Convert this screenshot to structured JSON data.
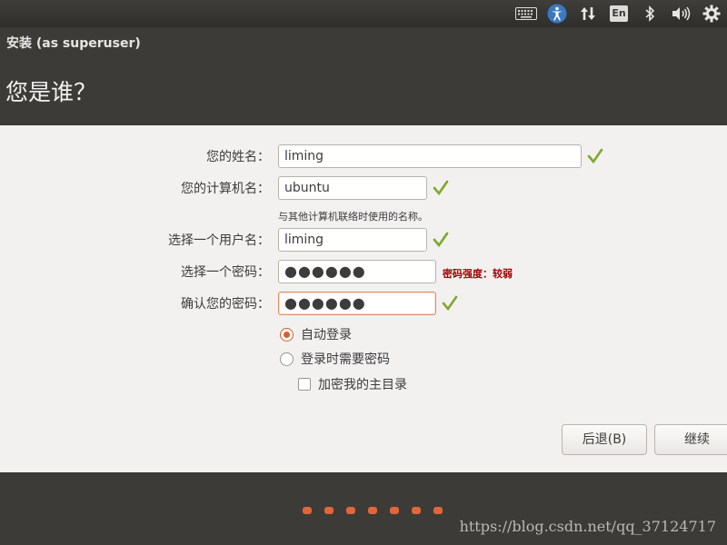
{
  "window": {
    "title": "安装 (as superuser)"
  },
  "page": {
    "title": "您是谁？"
  },
  "tray": {
    "items": [
      {
        "icon": "keyboard-icon"
      },
      {
        "icon": "accessibility-icon"
      },
      {
        "icon": "network-transfer-icon"
      },
      {
        "icon": "keyboard-layout-icon",
        "label": "En"
      },
      {
        "icon": "bluetooth-icon"
      },
      {
        "icon": "volume-icon"
      },
      {
        "icon": "settings-gear-icon"
      }
    ]
  },
  "form": {
    "name": {
      "label": "您的姓名：",
      "value": "liming"
    },
    "computer": {
      "label": "您的计算机名：",
      "value": "ubuntu",
      "hint": "与其他计算机联络时使用的名称。"
    },
    "username": {
      "label": "选择一个用户名：",
      "value": "liming"
    },
    "password": {
      "label": "选择一个密码：",
      "value": "●●●●●●",
      "strength": "密码强度：较弱"
    },
    "confirm": {
      "label": "确认您的密码：",
      "value": "●●●●●●"
    },
    "login_auto": {
      "label": "自动登录",
      "checked": true
    },
    "login_password": {
      "label": "登录时需要密码",
      "checked": false
    },
    "encrypt_home": {
      "label": "加密我的主目录",
      "checked": false
    }
  },
  "buttons": {
    "back": "后退(B)",
    "continue": "继续"
  },
  "footer": {
    "progress_steps": 7,
    "watermark": "https://blog.csdn.net/qq_37124717"
  },
  "colors": {
    "accent": "#e05b2a",
    "ok_check": "#7fa82a",
    "warning": "#a30000",
    "panel": "#3c3b37"
  }
}
